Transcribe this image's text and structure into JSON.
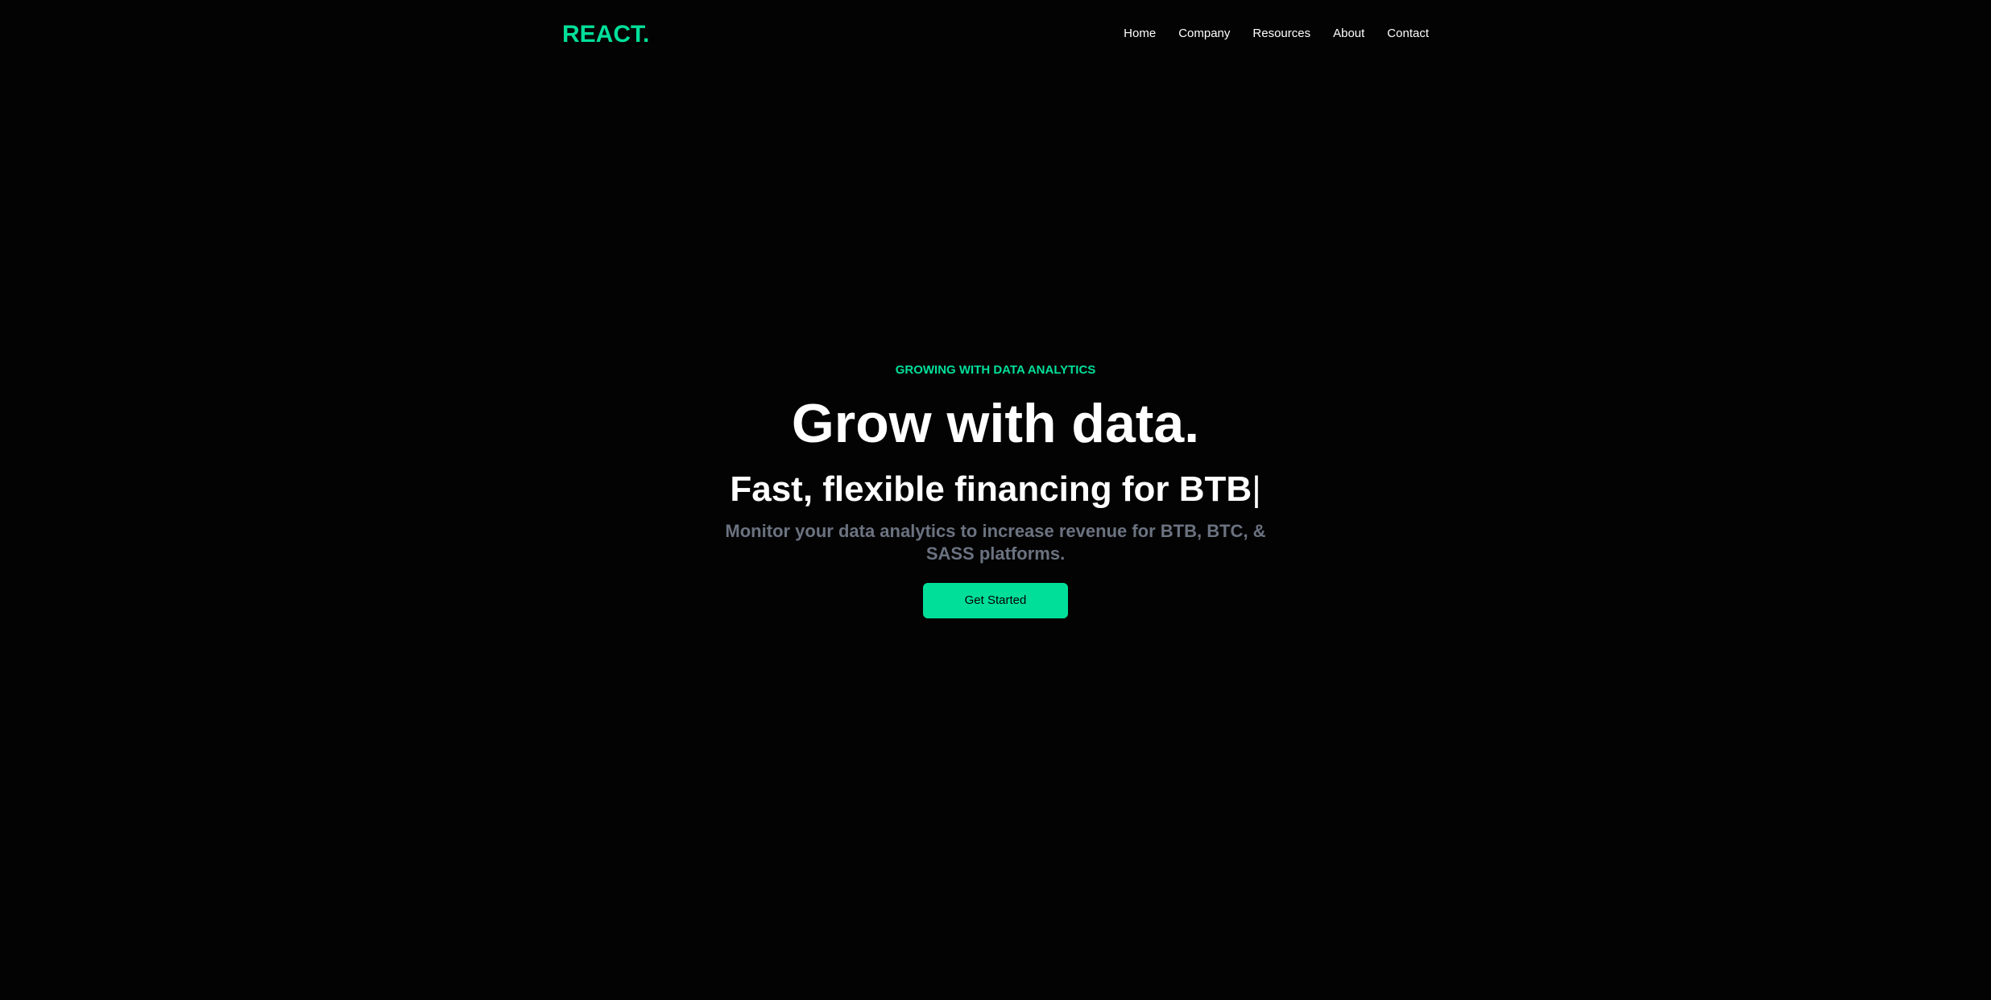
{
  "brand": {
    "logo_text": "REACT.",
    "accent_color": "#00df9a"
  },
  "nav": {
    "items": [
      "Home",
      "Company",
      "Resources",
      "About",
      "Contact"
    ]
  },
  "hero": {
    "eyebrow": "GROWING WITH DATA ANALYTICS",
    "headline": "Grow with data.",
    "subhead_prefix": "Fast, flexible financing for",
    "subhead_typed": "BTB",
    "cursor": "|",
    "description": "Monitor your data analytics to increase revenue for BTB, BTC, & SASS platforms.",
    "cta_label": "Get Started"
  },
  "colors": {
    "background": "#000000",
    "text_primary": "#ffffff",
    "text_muted": "#6b7280"
  }
}
